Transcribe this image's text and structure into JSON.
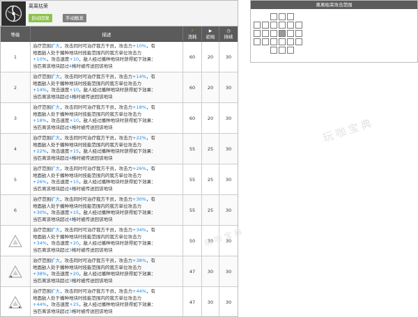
{
  "skill": {
    "name": "离离枯荣",
    "tags": {
      "auto": "自动回复",
      "manual": "手动触发"
    },
    "icon": "skill-icon"
  },
  "table": {
    "headers": {
      "level": "等级",
      "desc": "描述",
      "cost": "消耗",
      "init": "初始",
      "duration": "持续"
    },
    "header_icons": {
      "cost": "sp-bolt-icon",
      "init": "play-icon",
      "duration": "clock-icon"
    },
    "rows": [
      {
        "level": "1",
        "cost": "60",
        "init": "20",
        "duration": "30",
        "atk": "+10%",
        "range": "扩大",
        "spd": "+10",
        "l3b": "4"
      },
      {
        "level": "2",
        "cost": "60",
        "init": "20",
        "duration": "30",
        "atk": "+14%",
        "range": "扩大",
        "spd": "+10",
        "l3b": "4"
      },
      {
        "level": "3",
        "cost": "60",
        "init": "20",
        "duration": "30",
        "atk": "+18%",
        "range": "扩大",
        "spd": "+10",
        "l3b": "4"
      },
      {
        "level": "4",
        "cost": "55",
        "init": "25",
        "duration": "30",
        "atk": "+22%",
        "range": "扩大",
        "spd": "+15",
        "l3b": "4"
      },
      {
        "level": "5",
        "cost": "55",
        "init": "25",
        "duration": "30",
        "atk": "+26%",
        "range": "扩大",
        "spd": "+15",
        "l3b": "4"
      },
      {
        "level": "6",
        "cost": "55",
        "init": "25",
        "duration": "30",
        "atk": "+30%",
        "range": "扩大",
        "spd": "+15",
        "l3b": "4"
      },
      {
        "level": "",
        "spec": 1,
        "cost": "50",
        "init": "30",
        "duration": "30",
        "atk": "+34%",
        "range": "扩大",
        "spd": "+20",
        "l3b": "3"
      },
      {
        "level": "",
        "spec": 2,
        "cost": "47",
        "init": "30",
        "duration": "30",
        "atk": "+38%",
        "range": "扩大",
        "spd": "+20",
        "l3b": "3"
      },
      {
        "level": "",
        "spec": 3,
        "cost": "47",
        "init": "30",
        "duration": "30",
        "atk": "+44%",
        "range": "扩大",
        "spd": "+25",
        "l3b": "3"
      }
    ],
    "desc_text": {
      "l1a": "治疗范围",
      "l1b": "，攻击同时可治疗我方干员，攻击力",
      "l1c": "，有",
      "l2": "地面敌人处于播种地块时技能范围内的我方单位攻击力",
      "l3a": "，攻击速度",
      "l3b": "，敌人经过播种地块时获得如下效果：",
      "l4a": "当匹离该地块超过",
      "l4b": "格时被传送回该地块"
    }
  },
  "range": {
    "title": "离离枯荣攻击范围"
  },
  "watermark": {
    "text": "玩咖宝典"
  },
  "colors": {
    "accent_green": "#8bc34a",
    "highlight_blue": "#1e88e5",
    "header_bg": "#5b5b5b"
  }
}
